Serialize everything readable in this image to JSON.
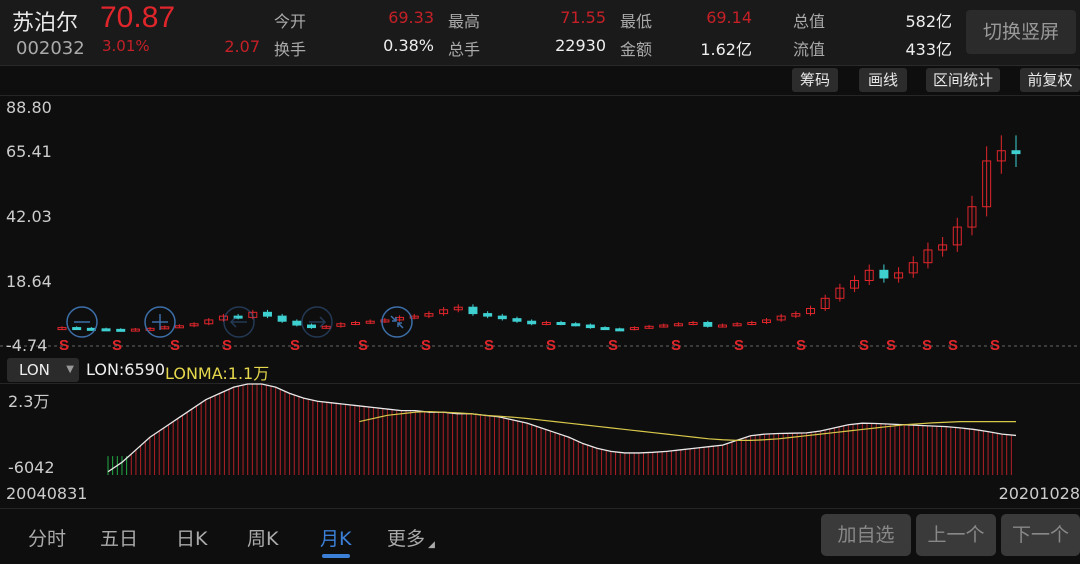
{
  "stock": {
    "name": "苏泊尔",
    "price": "70.87",
    "code": "002032",
    "change_pct": "3.01%",
    "change": "2.07"
  },
  "quote": [
    {
      "label": "今开",
      "value": "69.33",
      "color": "red"
    },
    {
      "label": "最高",
      "value": "71.55",
      "color": "red"
    },
    {
      "label": "最低",
      "value": "69.14",
      "color": "red"
    },
    {
      "label": "总值",
      "value": "582亿",
      "color": "white"
    },
    {
      "label": "换手",
      "value": "0.38%",
      "color": "white"
    },
    {
      "label": "总手",
      "value": "22930",
      "color": "white"
    },
    {
      "label": "金额",
      "value": "1.62亿",
      "color": "white"
    },
    {
      "label": "流值",
      "value": "433亿",
      "color": "white"
    }
  ],
  "switch_label": "切换竖屏",
  "toolbar": [
    "筹码",
    "画线",
    "区间统计",
    "前复权"
  ],
  "price_axis": [
    "88.80",
    "65.41",
    "42.03",
    "18.64",
    "-4.74"
  ],
  "signal_label": "S",
  "indicator": {
    "selected": "LON",
    "lon": "LON:6590",
    "lonma": "LONMA:1.1万",
    "axis_top": "2.3万",
    "axis_bottom": "-6042"
  },
  "dates": {
    "start": "20040831",
    "end": "20201028"
  },
  "tabs": [
    {
      "label": "分时"
    },
    {
      "label": "五日"
    },
    {
      "label": "日K"
    },
    {
      "label": "周K"
    },
    {
      "label": "月K",
      "active": true
    },
    {
      "label": "更多"
    }
  ],
  "buttons": [
    "加自选",
    "上一个",
    "下一个"
  ],
  "colors": {
    "up": "#e0262b",
    "down": "#3fd0d0",
    "lon_line": "#e8e8e8",
    "lonma_line": "#d8c84a",
    "active_tab": "#3b7fd6"
  },
  "chart_data": {
    "type": "candlestick",
    "period": "quarterly approximation of monthly K",
    "ylim": [
      -4.74,
      88.8
    ],
    "closes": [
      2.5,
      2.2,
      2.0,
      1.8,
      1.7,
      1.9,
      2.2,
      2.8,
      3.2,
      4.0,
      5.5,
      7.0,
      6.5,
      8.5,
      7.0,
      5.0,
      3.5,
      2.5,
      3.0,
      4.0,
      4.5,
      5.0,
      5.5,
      6.5,
      7.0,
      8.0,
      9.5,
      10.5,
      8.0,
      7.0,
      6.0,
      5.0,
      4.0,
      4.5,
      4.0,
      3.5,
      2.5,
      2.0,
      1.8,
      2.5,
      3.0,
      3.5,
      4.0,
      4.5,
      3.0,
      3.5,
      4.0,
      4.5,
      5.5,
      7.0,
      8.0,
      10.0,
      14.0,
      18.0,
      21.0,
      25.0,
      22.0,
      24.0,
      28.0,
      33.0,
      35.0,
      42.0,
      50.0,
      68.0,
      72.0,
      70.87
    ],
    "signals_at": [
      0,
      7,
      14,
      21,
      29,
      36,
      44,
      51,
      58,
      64,
      69,
      71,
      75,
      77,
      79,
      82
    ],
    "lon": [
      -5000,
      -2000,
      2000,
      6000,
      9000,
      12000,
      15000,
      18000,
      20000,
      22000,
      23000,
      23000,
      22000,
      20000,
      18500,
      17500,
      17000,
      16500,
      16000,
      15500,
      15000,
      14500,
      14500,
      14000,
      14000,
      13500,
      13500,
      13000,
      12500,
      11500,
      10500,
      9000,
      7500,
      6000,
      4000,
      2500,
      1500,
      1000,
      1000,
      1200,
      1500,
      2000,
      2500,
      3000,
      3500,
      5000,
      6500,
      7000,
      7200,
      7300,
      7400,
      8000,
      9000,
      10000,
      10500,
      10400,
      10200,
      10000,
      9800,
      9600,
      9400,
      9000,
      8500,
      7800,
      7000,
      6590
    ],
    "lonma": [
      null,
      null,
      null,
      null,
      null,
      null,
      null,
      null,
      null,
      null,
      null,
      null,
      null,
      null,
      null,
      null,
      null,
      null,
      11000,
      12000,
      13000,
      13500,
      14000,
      14200,
      14000,
      13800,
      13500,
      13000,
      12700,
      12400,
      12000,
      11500,
      11000,
      10500,
      10000,
      9500,
      9000,
      8500,
      8000,
      7500,
      7000,
      6500,
      6000,
      5500,
      5200,
      5000,
      5000,
      5200,
      5500,
      6000,
      6500,
      7000,
      7500,
      8000,
      8500,
      9000,
      9500,
      10000,
      10300,
      10600,
      10800,
      11000,
      11000,
      11000,
      11000,
      11000
    ]
  }
}
